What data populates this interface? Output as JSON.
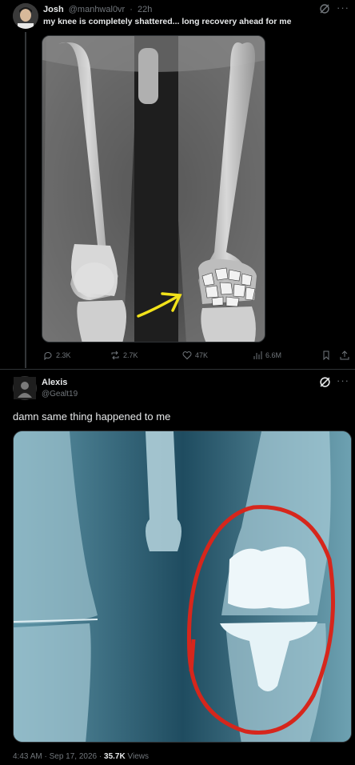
{
  "tweet1": {
    "name": "Josh",
    "handle": "@manhwal0vr",
    "separator": "·",
    "time": "22h",
    "text": "my knee is completely shattered... long recovery ahead for me",
    "grok_icon": "grok-icon",
    "more_icon": "more-icon",
    "media_alt": "x-ray legs",
    "actions": {
      "replies": "2.3K",
      "reposts": "2.7K",
      "likes": "47K",
      "views": "6.6M"
    }
  },
  "tweet2": {
    "name": "Alexis",
    "handle": "@Gealt19",
    "text": "damn same thing happened to me",
    "time": "4:43 AM",
    "separator": "·",
    "date": "Sep 17, 2026",
    "separator2": "·",
    "views_count": "35.7K",
    "views_label": "Views"
  },
  "colors": {
    "background": "#000000",
    "text": "#e7e9ea",
    "muted": "#71767b",
    "border": "#2f3336",
    "annotation_yellow": "#f2e21a",
    "annotation_red": "#d6261c"
  }
}
